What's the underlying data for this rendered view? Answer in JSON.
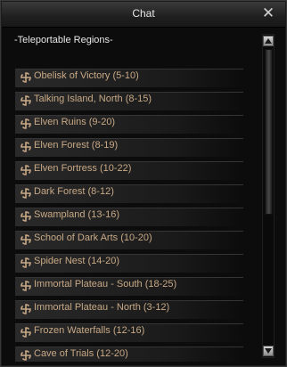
{
  "window": {
    "title": "Chat",
    "close_symbol": "✕"
  },
  "header_text": "-Teleportable Regions-",
  "colors": {
    "link_text": "#c8a986",
    "icon": "#c8a986"
  },
  "icons": {
    "item": "swirl-icon",
    "close": "close-icon",
    "scroll_up": "arrow-up-icon",
    "scroll_down": "arrow-down-icon"
  },
  "regions": [
    {
      "label": "Obelisk of Victory (5-10)"
    },
    {
      "label": "Talking Island, North (8-15)"
    },
    {
      "label": "Elven Ruins (9-20)"
    },
    {
      "label": "Elven Forest (8-19)"
    },
    {
      "label": "Elven Fortress (10-22)"
    },
    {
      "label": "Dark Forest (8-12)"
    },
    {
      "label": "Swampland (13-16)"
    },
    {
      "label": "School of Dark Arts (10-20)"
    },
    {
      "label": "Spider Nest (14-20)"
    },
    {
      "label": "Immortal Plateau - South (18-25)"
    },
    {
      "label": "Immortal Plateau - North (3-12)"
    },
    {
      "label": "Frozen Waterfalls (12-16)"
    },
    {
      "label": "Cave of Trials (12-20)"
    }
  ]
}
